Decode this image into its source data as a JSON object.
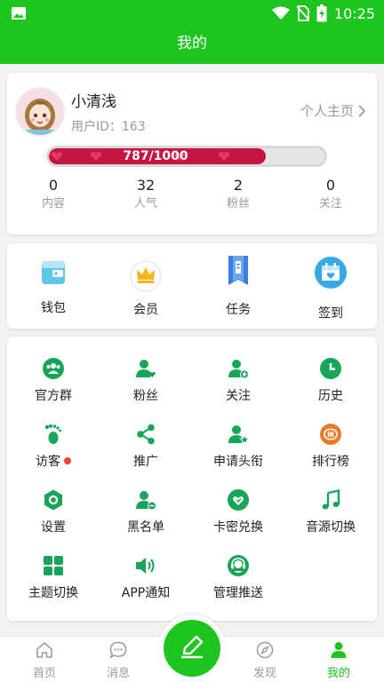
{
  "status_bar": {
    "time": "10:25"
  },
  "app_bar": {
    "title": "我的"
  },
  "profile": {
    "username": "小清浅",
    "user_id_label": "用户ID：",
    "user_id": "163",
    "homepage_link": "个人主页",
    "exp_text": "787/1000",
    "exp_fraction": 0.787,
    "stats": [
      {
        "value": "0",
        "label": "内容"
      },
      {
        "value": "32",
        "label": "人气"
      },
      {
        "value": "2",
        "label": "粉丝"
      },
      {
        "value": "0",
        "label": "关注"
      }
    ]
  },
  "quick_actions": [
    {
      "label": "钱包",
      "icon": "wallet-icon"
    },
    {
      "label": "会员",
      "icon": "crown-icon"
    },
    {
      "label": "任务",
      "icon": "task-icon"
    },
    {
      "label": "签到",
      "icon": "calendar-icon"
    }
  ],
  "menu_grid": [
    {
      "label": "官方群",
      "icon": "group-icon"
    },
    {
      "label": "粉丝",
      "icon": "fans-icon"
    },
    {
      "label": "关注",
      "icon": "follow-icon"
    },
    {
      "label": "历史",
      "icon": "history-icon"
    },
    {
      "label": "访客",
      "icon": "footprint-icon",
      "badge": true
    },
    {
      "label": "推广",
      "icon": "share-icon"
    },
    {
      "label": "申请头衔",
      "icon": "title-icon"
    },
    {
      "label": "排行榜",
      "icon": "ranking-icon"
    },
    {
      "label": "设置",
      "icon": "settings-icon"
    },
    {
      "label": "黑名单",
      "icon": "blacklist-icon"
    },
    {
      "label": "卡密兑换",
      "icon": "redeem-icon"
    },
    {
      "label": "音源切换",
      "icon": "music-icon"
    },
    {
      "label": "主题切换",
      "icon": "theme-icon"
    },
    {
      "label": "APP通知",
      "icon": "speaker-icon"
    },
    {
      "label": "管理推送",
      "icon": "headset-icon"
    }
  ],
  "tab_bar": {
    "tabs": [
      {
        "label": "首页",
        "icon": "home-icon"
      },
      {
        "label": "消息",
        "icon": "message-icon"
      },
      {
        "label": "发现",
        "icon": "compass-icon"
      },
      {
        "label": "我的",
        "icon": "user-icon",
        "active": true
      }
    ],
    "center_icon": "edit-icon"
  },
  "colors": {
    "primary_green": "#1ec51e",
    "exp_red": "#c4163f",
    "menu_green": "#18a55a",
    "badge_red": "#f0482d"
  }
}
